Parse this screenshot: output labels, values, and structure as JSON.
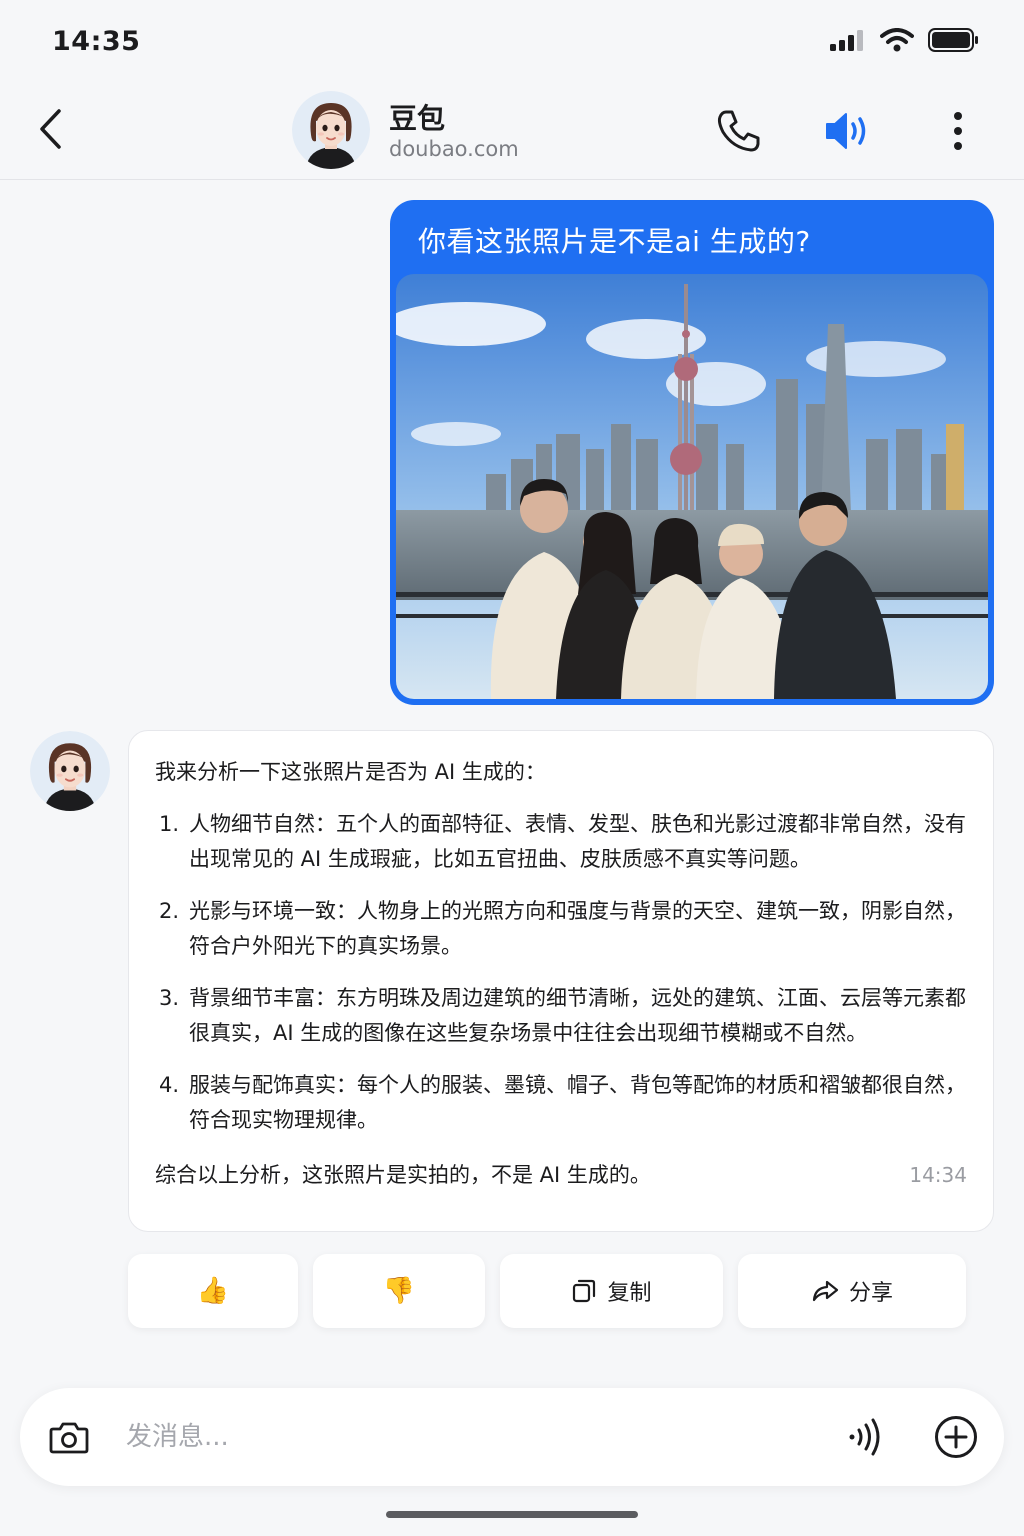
{
  "status_bar": {
    "time": "14:35",
    "icons": [
      "signal-icon",
      "wifi-icon",
      "battery-icon"
    ]
  },
  "header": {
    "name": "豆包",
    "subtitle": "doubao.com",
    "icons": [
      "back-icon",
      "phone-icon",
      "speaker-icon",
      "more-vertical-icon"
    ],
    "accent": "#1f6ff2"
  },
  "user_message": {
    "text": "你看这张照片是不是ai 生成的?",
    "image": "group-photo-shanghai-bund",
    "bubble_color": "#1f6ff2"
  },
  "bot_message": {
    "intro": "我来分析一下这张照片是否为 AI 生成的：",
    "items": [
      {
        "num": "1.",
        "text": "人物细节自然：五个人的面部特征、表情、发型、肤色和光影过渡都非常自然，没有出现常见的 AI 生成瑕疵，比如五官扭曲、皮肤质感不真实等问题。"
      },
      {
        "num": "2.",
        "text": "光影与环境一致：人物身上的光照方向和强度与背景的天空、建筑一致，阴影自然，符合户外阳光下的真实场景。"
      },
      {
        "num": "3.",
        "text": "背景细节丰富：东方明珠及周边建筑的细节清晰，远处的建筑、江面、云层等元素都很真实，AI 生成的图像在这些复杂场景中往往会出现细节模糊或不自然。"
      },
      {
        "num": "4.",
        "text": "服装与配饰真实：每个人的服装、墨镜、帽子、背包等配饰的材质和褶皱都很自然，符合现实物理规律。"
      }
    ],
    "summary": "综合以上分析，这张照片是实拍的，不是 AI 生成的。",
    "time": "14:34"
  },
  "actions": {
    "like_icon": "👍",
    "dislike_icon": "👎",
    "copy_label": "复制",
    "share_label": "分享"
  },
  "input": {
    "placeholder": "发消息..."
  }
}
